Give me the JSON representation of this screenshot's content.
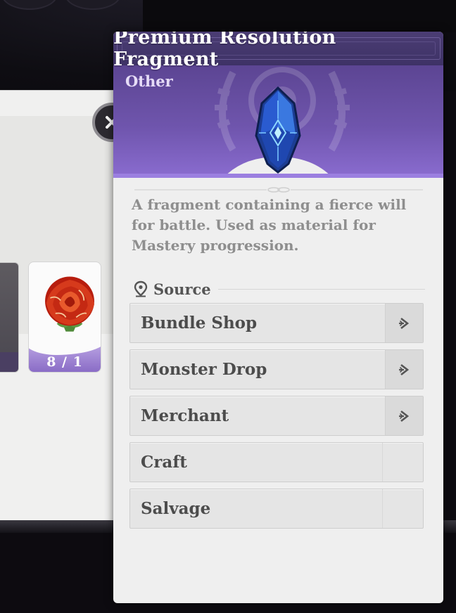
{
  "background": {
    "card": {
      "count_label": "8 / 1",
      "icon": "red-rose-icon"
    },
    "close_icon": "close-icon"
  },
  "tooltip": {
    "title": "Premium Resolution Fragment",
    "category": "Other",
    "item_icon": "blue-crystal-fragment-icon",
    "description": "A fragment containing a fierce will for battle. Used as material for Mastery progression.",
    "source_heading": "Source",
    "sources": [
      {
        "label": "Bundle Shop",
        "has_link": true
      },
      {
        "label": "Monster Drop",
        "has_link": true
      },
      {
        "label": "Merchant",
        "has_link": true
      },
      {
        "label": "Craft",
        "has_link": false
      },
      {
        "label": "Salvage",
        "has_link": false
      }
    ]
  },
  "colors": {
    "title_bar": "#43366c",
    "header_purple": "#6f55ad",
    "panel_bg": "#efefef",
    "gem_blue": "#2a5bd0"
  }
}
